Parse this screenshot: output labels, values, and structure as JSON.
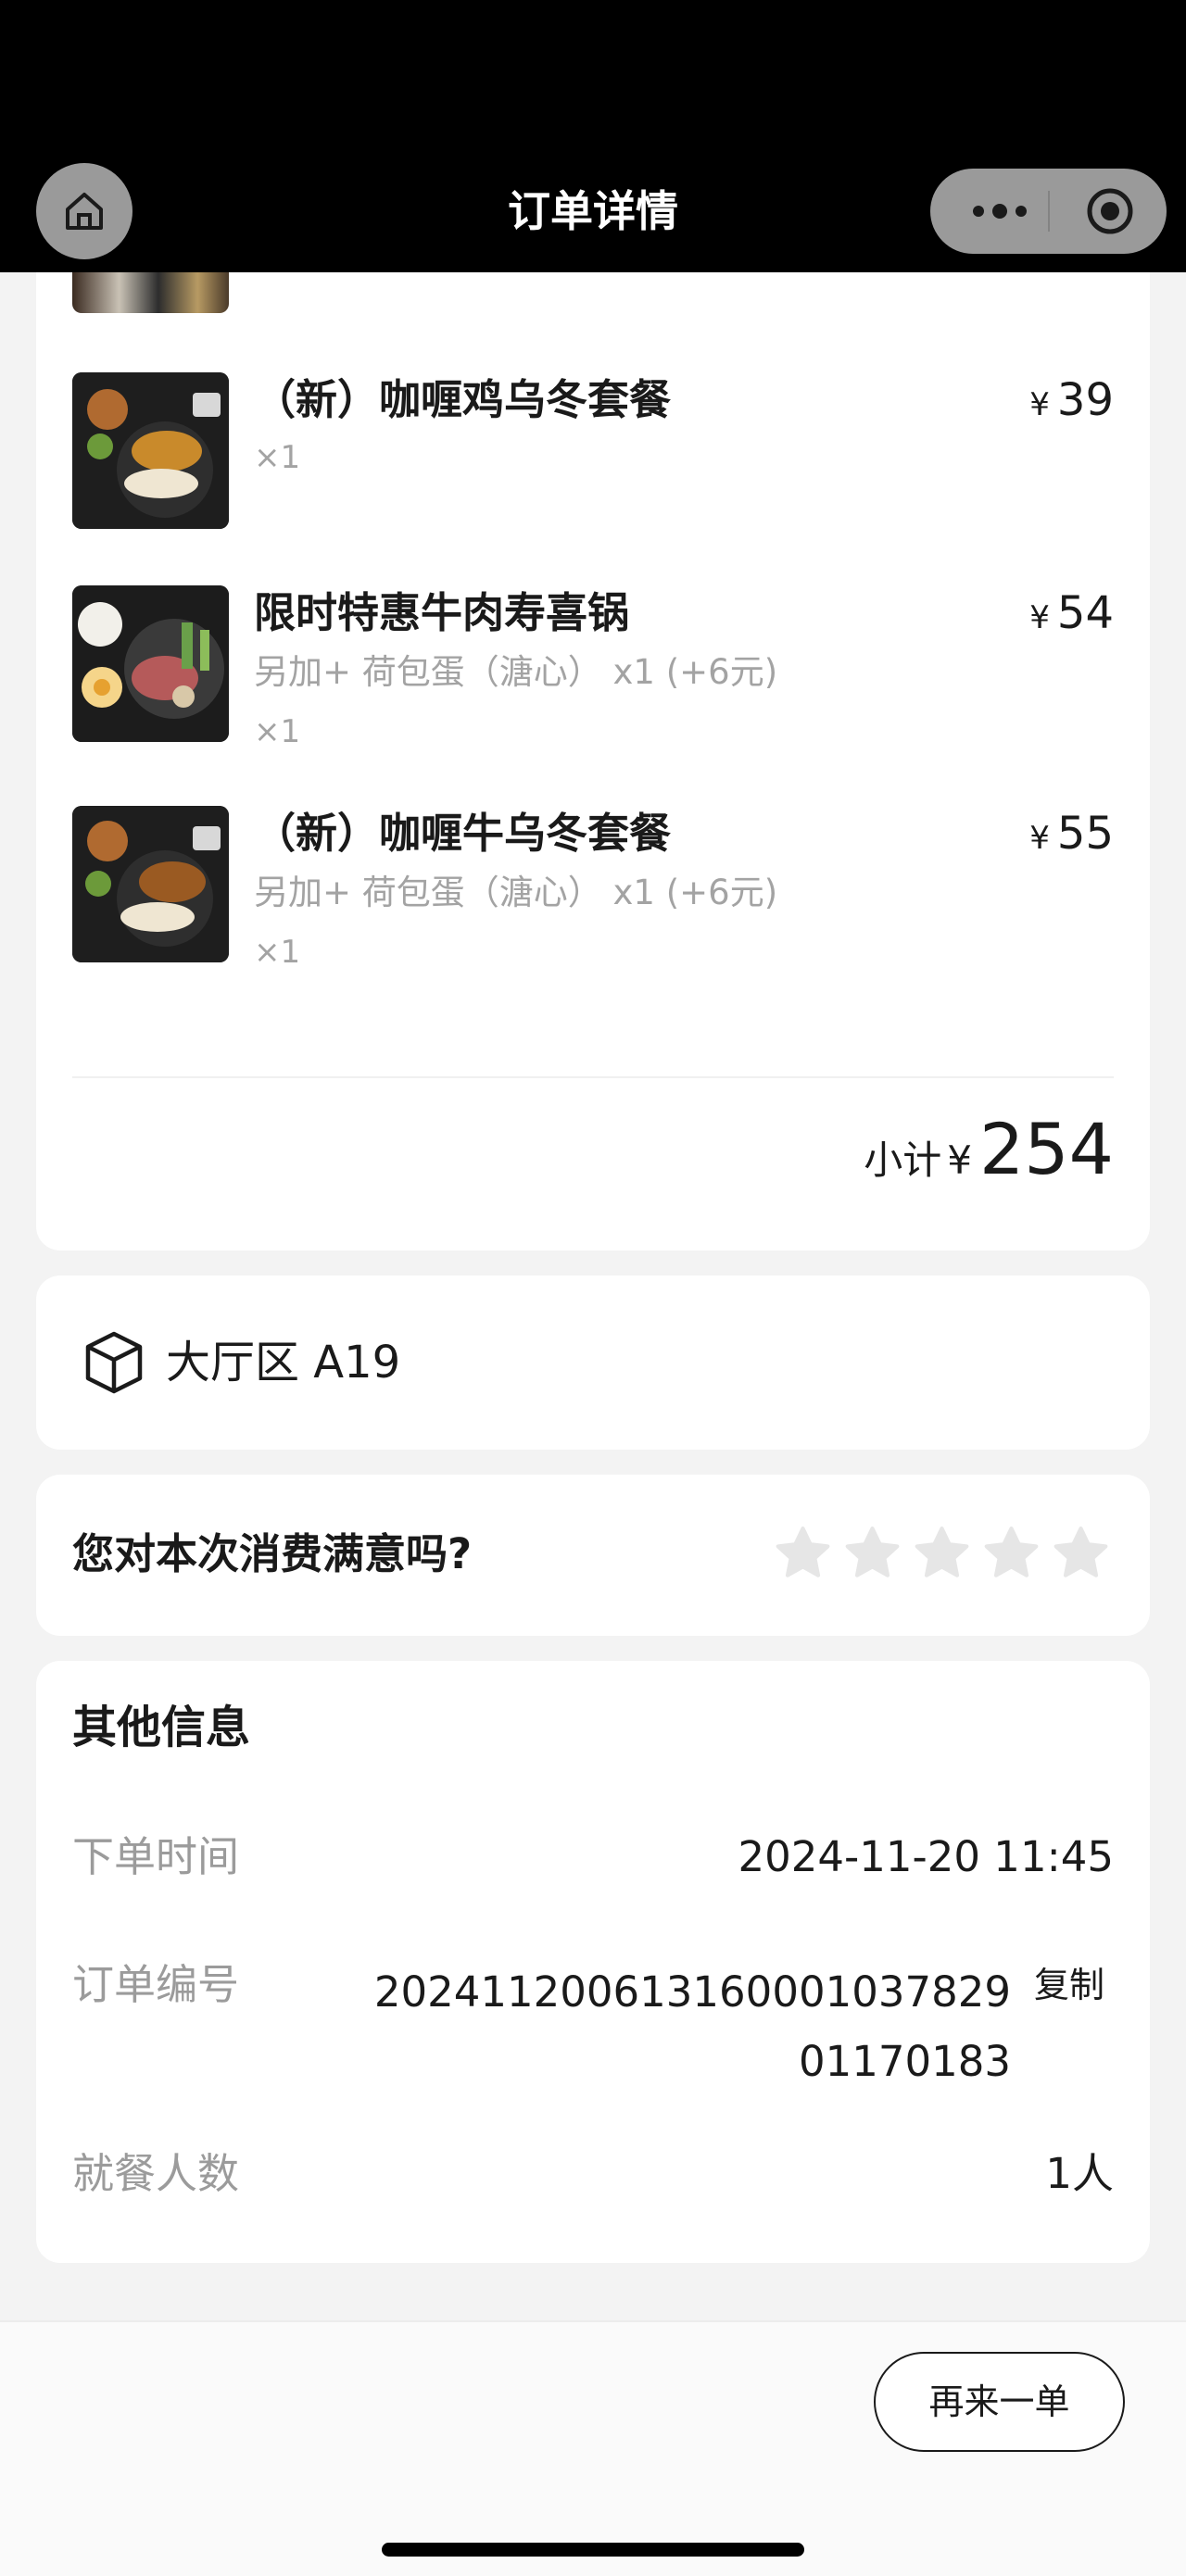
{
  "header": {
    "title": "订单详情"
  },
  "order_items": [
    {
      "name": "（新）咖喱鸡乌冬套餐",
      "currency": "¥",
      "price": "39",
      "extra": "",
      "qty": "×1"
    },
    {
      "name": "限时特惠牛肉寿喜锅",
      "currency": "¥",
      "price": "54",
      "extra": "另加+ 荷包蛋（溏心） x1 (+6元)",
      "qty": "×1"
    },
    {
      "name": "（新）咖喱牛乌冬套餐",
      "currency": "¥",
      "price": "55",
      "extra": "另加+ 荷包蛋（溏心） x1 (+6元)",
      "qty": "×1"
    }
  ],
  "subtotal": {
    "label": "小计",
    "currency": "¥",
    "amount": "254"
  },
  "table": {
    "label": "大厅区 A19"
  },
  "rating": {
    "question": "您对本次消费满意吗?",
    "stars": 0,
    "max_stars": 5
  },
  "other_info": {
    "title": "其他信息",
    "order_time_label": "下单时间",
    "order_time": "2024-11-20 11:45",
    "order_no_label": "订单编号",
    "order_no_line1": "202411200613160001037829",
    "order_no_line2": "01170183",
    "copy_label": "复制",
    "diners_label": "就餐人数",
    "diners": "1人"
  },
  "bottom": {
    "reorder_label": "再来一单"
  },
  "colors": {
    "header_bg": "#000000",
    "capsule_bg": "#9a9a9a",
    "muted_text": "#9b9b9b",
    "star": "#e6e6e6"
  },
  "icons": {
    "home": "home-icon",
    "more": "more-dots-icon",
    "target": "target-icon",
    "table": "cube-icon",
    "star": "star-icon"
  }
}
